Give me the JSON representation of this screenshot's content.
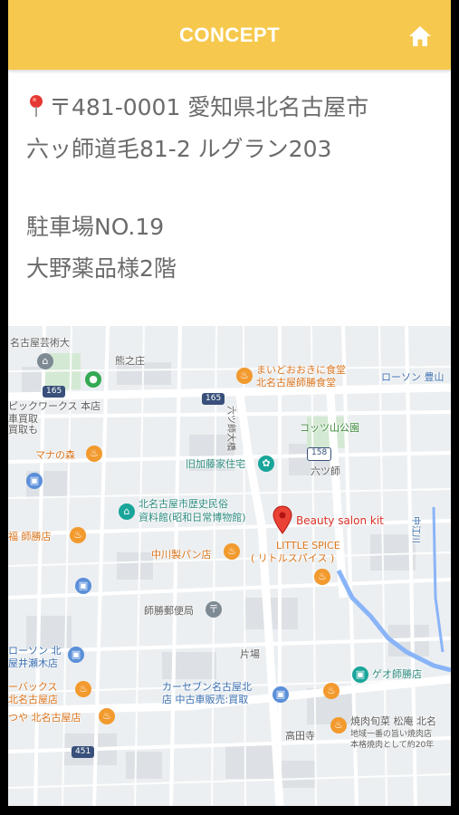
{
  "header": {
    "title": "CONCEPT",
    "home_icon": "home-icon"
  },
  "address": {
    "pin_icon": "map-pin-icon",
    "line1": "〒481-0001 愛知県北名古屋市",
    "line2": "六ッ師道毛81-2 ルグラン203",
    "line3": "駐車場NO.19",
    "line4": "大野薬品様2階"
  },
  "map": {
    "labels": {
      "art_univ": "名古屋芸術大",
      "kumanosho": "熊之庄",
      "maidookini": "まいどおおきに食堂",
      "maidookini_sub": "北名古屋師勝食堂",
      "lawson_top": "ローソン 豊山",
      "pickworks": "ピックワークス 本店",
      "pickworks_sub1": "車買取",
      "pickworks_sub2": "買取も",
      "rokutsushi_road": "六ツ師大橋",
      "kotsuyama": "コッツ山公園",
      "mana": "マナの森",
      "katou": "旧加藤家住宅",
      "rokutsushi": "六ツ師",
      "museum1": "北名古屋市歴史民俗",
      "museum2": "資料館(昭和日常博物館)",
      "salon": "Beauty salon kit",
      "spice1": "LITTLE SPICE",
      "spice2": "( リトルスパイス )",
      "shikatsu_store": "福 師勝店",
      "nakagawa": "中川製パン店",
      "nakaetagawa": "中江川",
      "shikatsu_post": "師勝郵便局",
      "lawson_bottom1": "ローソン 北",
      "lawson_bottom2": "屋井瀬木店",
      "katabou": "片場",
      "geo": "ゲオ師勝店",
      "starbucks1": "ーバックス",
      "starbucks2": "北名古屋店",
      "carseven1": "カーセブン名古屋北",
      "carseven2": "店 中古車販売:買取",
      "tsuya": "つや 北名古屋店",
      "yakiniku1": "焼肉旬菜 松庵 北名",
      "yakiniku2": "地域一番の旨い焼肉店",
      "yakiniku3": "本格焼肉として約20年",
      "takadaji": "高田寺",
      "route_165a": "165",
      "route_165b": "165",
      "route_158": "158",
      "route_451": "451"
    },
    "icons": {
      "university": "university-icon",
      "green_marker": "green-location-icon",
      "restaurant": "restaurant-icon",
      "shopping": "shopping-bag-icon",
      "museum": "museum-icon",
      "park": "park-icon",
      "post": "post-office-icon",
      "salon_marker": "red-map-marker-icon"
    },
    "colors": {
      "road": "#ffffff",
      "major_road": "#f8d36a",
      "river": "#8ab4f8",
      "block": "#dfe3e6",
      "marker": "#ea4335"
    }
  }
}
